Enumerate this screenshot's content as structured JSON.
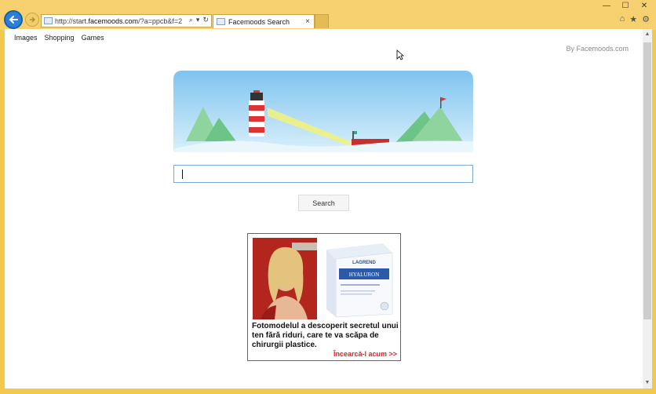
{
  "browser": {
    "address_prefix": "http://start.",
    "address_domain": "facemoods.com",
    "address_suffix": "/?a=ppcb&f=2",
    "tab_title": "Facemoods Search",
    "tab_close": "×",
    "search_icon": "⌕",
    "dropdown_icon": "▾",
    "refresh_icon": "↻",
    "window_controls": [
      "—",
      "☐",
      "✕"
    ],
    "tool_icons": [
      "⌂",
      "★",
      "⚙"
    ]
  },
  "page": {
    "nav_links": [
      "Images",
      "Shopping",
      "Games"
    ],
    "byline": "By Facemoods.com",
    "search_value": "",
    "search_button": "Search"
  },
  "ad": {
    "headline": "Fotomodelul a descoperit secretul unui ten fără riduri, care te va scăpa de chirurgii plastice.",
    "cta": "Încearcă-l acum >>",
    "product_brand": "LAGREND",
    "product_name": "HYALURON"
  },
  "colors": {
    "accent_blue": "#2a7fd6",
    "frame_yellow": "#f2c94c",
    "cta_red": "#d22222"
  }
}
